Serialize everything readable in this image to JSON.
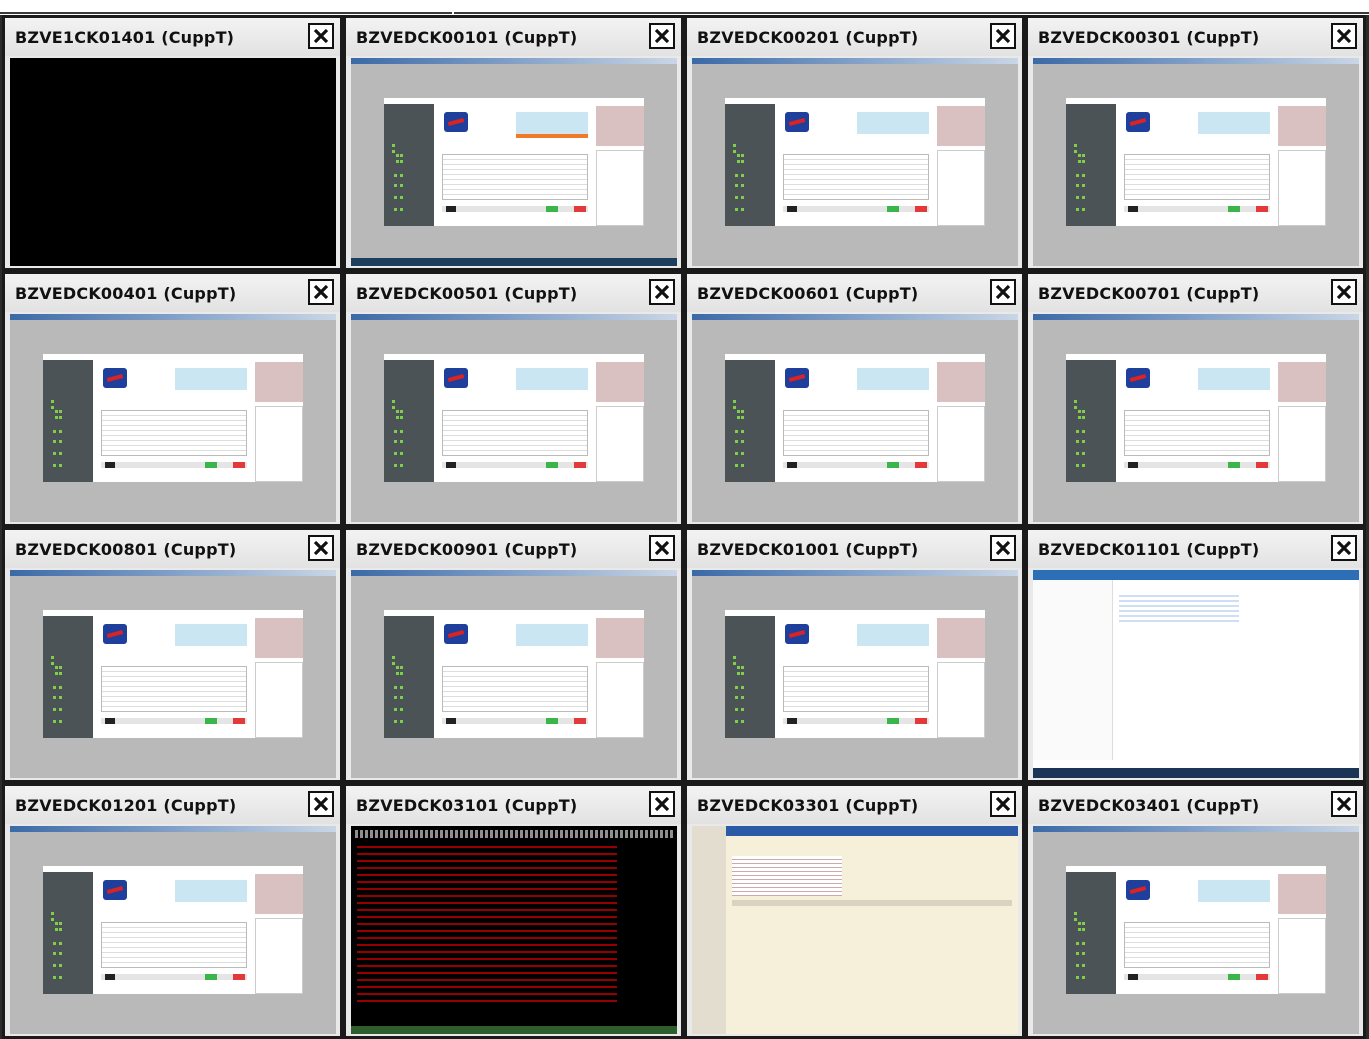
{
  "tiles": [
    {
      "title": "BZVE1CK01401 (CuppT)",
      "kind": "black"
    },
    {
      "title": "BZVEDCK00101 (CuppT)",
      "kind": "app-orange"
    },
    {
      "title": "BZVEDCK00201 (CuppT)",
      "kind": "app"
    },
    {
      "title": "BZVEDCK00301 (CuppT)",
      "kind": "app"
    },
    {
      "title": "BZVEDCK00401 (CuppT)",
      "kind": "app"
    },
    {
      "title": "BZVEDCK00501 (CuppT)",
      "kind": "app"
    },
    {
      "title": "BZVEDCK00601 (CuppT)",
      "kind": "app"
    },
    {
      "title": "BZVEDCK00701 (CuppT)",
      "kind": "app"
    },
    {
      "title": "BZVEDCK00801 (CuppT)",
      "kind": "app"
    },
    {
      "title": "BZVEDCK00901 (CuppT)",
      "kind": "app"
    },
    {
      "title": "BZVEDCK01001 (CuppT)",
      "kind": "app"
    },
    {
      "title": "BZVEDCK01101 (CuppT)",
      "kind": "explorer"
    },
    {
      "title": "BZVEDCK01201 (CuppT)",
      "kind": "app"
    },
    {
      "title": "BZVEDCK03101 (CuppT)",
      "kind": "terminal"
    },
    {
      "title": "BZVEDCK03301 (CuppT)",
      "kind": "web"
    },
    {
      "title": "BZVEDCK03401 (CuppT)",
      "kind": "app"
    }
  ],
  "icons": {
    "close": "close-icon"
  }
}
